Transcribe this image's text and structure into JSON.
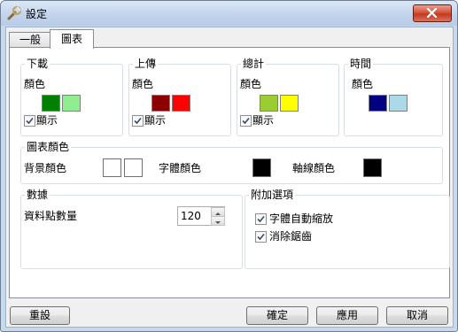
{
  "window": {
    "title": "設定"
  },
  "tabs": [
    {
      "label": "一般"
    },
    {
      "label": "圖表"
    }
  ],
  "download": {
    "title": "下載",
    "color_label": "顏色",
    "colors": [
      "#008000",
      "#90ee90"
    ],
    "show_label": "顯示",
    "show_checked": true
  },
  "upload": {
    "title": "上傳",
    "color_label": "顏色",
    "colors": [
      "#8b0000",
      "#ff0000"
    ],
    "show_label": "顯示",
    "show_checked": true
  },
  "total": {
    "title": "總計",
    "color_label": "顏色",
    "colors": [
      "#9acd32",
      "#ffff00"
    ],
    "show_label": "顯示",
    "show_checked": true
  },
  "time": {
    "title": "時間",
    "color_label": "顏色",
    "colors": [
      "#000080",
      "#add8e6"
    ]
  },
  "chart_colors": {
    "title": "圖表顏色",
    "background_label": "背景顏色",
    "background_colors": [
      "#ffffff",
      "#ffffff"
    ],
    "font_label": "字體顏色",
    "font_color": "#000000",
    "axis_label": "軸線顏色",
    "axis_color": "#000000"
  },
  "data": {
    "title": "數據",
    "points_label": "資料點數量",
    "points_value": "120"
  },
  "extra": {
    "title": "附加選項",
    "autoscale_label": "字體自動縮放",
    "autoscale_checked": true,
    "antialias_label": "消除鋸齒",
    "antialias_checked": true
  },
  "buttons": {
    "reset": "重設",
    "ok": "確定",
    "apply": "應用",
    "cancel": "取消"
  }
}
